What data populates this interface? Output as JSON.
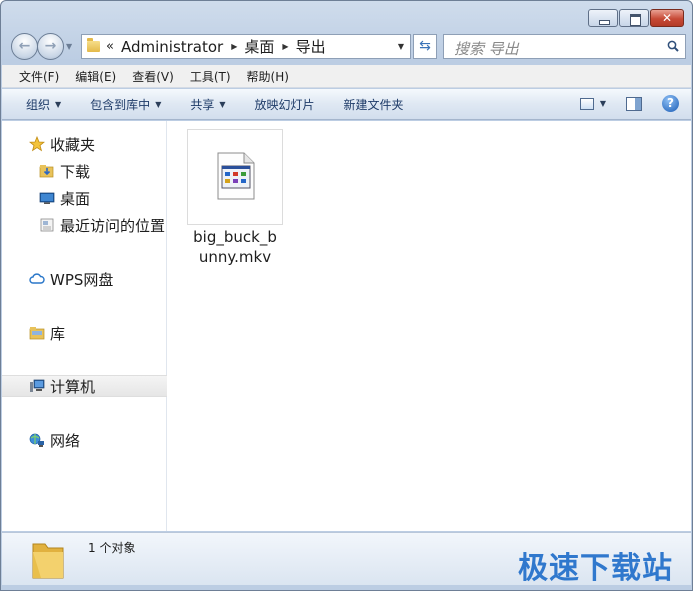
{
  "window": {
    "caption_buttons": [
      "minimize",
      "maximize",
      "close"
    ]
  },
  "address_bar": {
    "overflow": "«",
    "segments": [
      "Administrator",
      "桌面",
      "导出"
    ]
  },
  "search": {
    "placeholder": "搜索 导出"
  },
  "menu": {
    "items": [
      "文件(F)",
      "编辑(E)",
      "查看(V)",
      "工具(T)",
      "帮助(H)"
    ]
  },
  "toolbar": {
    "organize": "组织",
    "include_library": "包含到库中",
    "share": "共享",
    "slideshow": "放映幻灯片",
    "new_folder": "新建文件夹"
  },
  "nav_pane": {
    "favorites": "收藏夹",
    "downloads": "下载",
    "desktop": "桌面",
    "recent": "最近访问的位置",
    "wps": "WPS网盘",
    "libraries": "库",
    "computer": "计算机",
    "network": "网络"
  },
  "files": [
    {
      "name_line1": "big_buck_b",
      "name_line2": "unny.mkv"
    }
  ],
  "status": {
    "count": "1 个对象",
    "watermark": "极速下载站"
  },
  "colors": {
    "accent": "#1d6cc9",
    "chrome": "#bccde3"
  }
}
